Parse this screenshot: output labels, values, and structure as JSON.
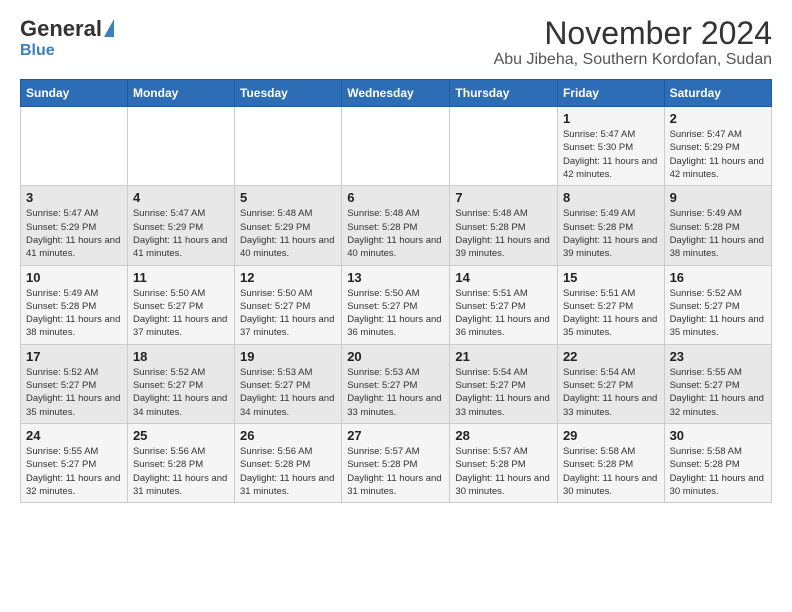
{
  "header": {
    "logo_general": "General",
    "logo_blue": "Blue",
    "title": "November 2024",
    "subtitle": "Abu Jibeha, Southern Kordofan, Sudan"
  },
  "weekdays": [
    "Sunday",
    "Monday",
    "Tuesday",
    "Wednesday",
    "Thursday",
    "Friday",
    "Saturday"
  ],
  "weeks": [
    [
      {
        "day": "",
        "info": ""
      },
      {
        "day": "",
        "info": ""
      },
      {
        "day": "",
        "info": ""
      },
      {
        "day": "",
        "info": ""
      },
      {
        "day": "",
        "info": ""
      },
      {
        "day": "1",
        "info": "Sunrise: 5:47 AM\nSunset: 5:30 PM\nDaylight: 11 hours and 42 minutes."
      },
      {
        "day": "2",
        "info": "Sunrise: 5:47 AM\nSunset: 5:29 PM\nDaylight: 11 hours and 42 minutes."
      }
    ],
    [
      {
        "day": "3",
        "info": "Sunrise: 5:47 AM\nSunset: 5:29 PM\nDaylight: 11 hours and 41 minutes."
      },
      {
        "day": "4",
        "info": "Sunrise: 5:47 AM\nSunset: 5:29 PM\nDaylight: 11 hours and 41 minutes."
      },
      {
        "day": "5",
        "info": "Sunrise: 5:48 AM\nSunset: 5:29 PM\nDaylight: 11 hours and 40 minutes."
      },
      {
        "day": "6",
        "info": "Sunrise: 5:48 AM\nSunset: 5:28 PM\nDaylight: 11 hours and 40 minutes."
      },
      {
        "day": "7",
        "info": "Sunrise: 5:48 AM\nSunset: 5:28 PM\nDaylight: 11 hours and 39 minutes."
      },
      {
        "day": "8",
        "info": "Sunrise: 5:49 AM\nSunset: 5:28 PM\nDaylight: 11 hours and 39 minutes."
      },
      {
        "day": "9",
        "info": "Sunrise: 5:49 AM\nSunset: 5:28 PM\nDaylight: 11 hours and 38 minutes."
      }
    ],
    [
      {
        "day": "10",
        "info": "Sunrise: 5:49 AM\nSunset: 5:28 PM\nDaylight: 11 hours and 38 minutes."
      },
      {
        "day": "11",
        "info": "Sunrise: 5:50 AM\nSunset: 5:27 PM\nDaylight: 11 hours and 37 minutes."
      },
      {
        "day": "12",
        "info": "Sunrise: 5:50 AM\nSunset: 5:27 PM\nDaylight: 11 hours and 37 minutes."
      },
      {
        "day": "13",
        "info": "Sunrise: 5:50 AM\nSunset: 5:27 PM\nDaylight: 11 hours and 36 minutes."
      },
      {
        "day": "14",
        "info": "Sunrise: 5:51 AM\nSunset: 5:27 PM\nDaylight: 11 hours and 36 minutes."
      },
      {
        "day": "15",
        "info": "Sunrise: 5:51 AM\nSunset: 5:27 PM\nDaylight: 11 hours and 35 minutes."
      },
      {
        "day": "16",
        "info": "Sunrise: 5:52 AM\nSunset: 5:27 PM\nDaylight: 11 hours and 35 minutes."
      }
    ],
    [
      {
        "day": "17",
        "info": "Sunrise: 5:52 AM\nSunset: 5:27 PM\nDaylight: 11 hours and 35 minutes."
      },
      {
        "day": "18",
        "info": "Sunrise: 5:52 AM\nSunset: 5:27 PM\nDaylight: 11 hours and 34 minutes."
      },
      {
        "day": "19",
        "info": "Sunrise: 5:53 AM\nSunset: 5:27 PM\nDaylight: 11 hours and 34 minutes."
      },
      {
        "day": "20",
        "info": "Sunrise: 5:53 AM\nSunset: 5:27 PM\nDaylight: 11 hours and 33 minutes."
      },
      {
        "day": "21",
        "info": "Sunrise: 5:54 AM\nSunset: 5:27 PM\nDaylight: 11 hours and 33 minutes."
      },
      {
        "day": "22",
        "info": "Sunrise: 5:54 AM\nSunset: 5:27 PM\nDaylight: 11 hours and 33 minutes."
      },
      {
        "day": "23",
        "info": "Sunrise: 5:55 AM\nSunset: 5:27 PM\nDaylight: 11 hours and 32 minutes."
      }
    ],
    [
      {
        "day": "24",
        "info": "Sunrise: 5:55 AM\nSunset: 5:27 PM\nDaylight: 11 hours and 32 minutes."
      },
      {
        "day": "25",
        "info": "Sunrise: 5:56 AM\nSunset: 5:28 PM\nDaylight: 11 hours and 31 minutes."
      },
      {
        "day": "26",
        "info": "Sunrise: 5:56 AM\nSunset: 5:28 PM\nDaylight: 11 hours and 31 minutes."
      },
      {
        "day": "27",
        "info": "Sunrise: 5:57 AM\nSunset: 5:28 PM\nDaylight: 11 hours and 31 minutes."
      },
      {
        "day": "28",
        "info": "Sunrise: 5:57 AM\nSunset: 5:28 PM\nDaylight: 11 hours and 30 minutes."
      },
      {
        "day": "29",
        "info": "Sunrise: 5:58 AM\nSunset: 5:28 PM\nDaylight: 11 hours and 30 minutes."
      },
      {
        "day": "30",
        "info": "Sunrise: 5:58 AM\nSunset: 5:28 PM\nDaylight: 11 hours and 30 minutes."
      }
    ]
  ]
}
